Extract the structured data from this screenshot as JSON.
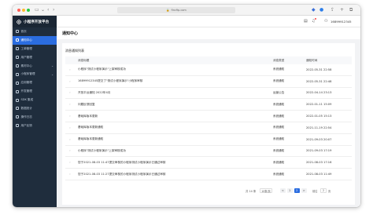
{
  "browser": {
    "url": "fincfip.com"
  },
  "sidebar": {
    "brand": "小程序开放平台",
    "items": [
      {
        "label": "首页",
        "active": false,
        "has_arrow": false
      },
      {
        "label": "通知中心",
        "active": true,
        "has_arrow": false
      },
      {
        "label": "工单管理",
        "active": false,
        "has_arrow": false
      },
      {
        "label": "用户管理",
        "active": false,
        "has_arrow": false
      },
      {
        "label": "素材中心",
        "active": false,
        "has_arrow": true
      },
      {
        "label": "小程序管理",
        "active": false,
        "has_arrow": true
      },
      {
        "label": "应用管理",
        "active": false,
        "has_arrow": false
      },
      {
        "label": "开发管理",
        "active": false,
        "has_arrow": false
      },
      {
        "label": "SDK 集成",
        "active": false,
        "has_arrow": false
      },
      {
        "label": "数据统计",
        "active": false,
        "has_arrow": false
      },
      {
        "label": "操作日志",
        "active": false,
        "has_arrow": false
      },
      {
        "label": "用户反馈",
        "active": false,
        "has_arrow": false
      }
    ]
  },
  "header": {
    "username": "16899912345"
  },
  "page": {
    "title": "通知中心",
    "card_title": "消息通知列表"
  },
  "table": {
    "columns": [
      "消息标题",
      "消息类型",
      "通知时间"
    ],
    "rows": [
      {
        "title": "小程序\"测试小程序演示\"上架审核成功",
        "type": "系统通知",
        "time": "2022-05-31 22:58"
      },
      {
        "title": "16899912345提交了\"测试小程序演示\"小程序审核",
        "type": "系统通知",
        "time": "2022-05-31 22:48"
      },
      {
        "title": "开放平台通知 2022年4月",
        "type": "运营公告",
        "time": "2022-04-14 23:13"
      },
      {
        "title": "问题反馈回复",
        "type": "系统通知",
        "time": "2022-01-11 15:09"
      },
      {
        "title": "基础库版本更新",
        "type": "系统通知",
        "time": "2022-01-05 15:13"
      },
      {
        "title": "基础库版本更新通知",
        "type": "系统通知",
        "time": "2021-11-19 22:54"
      },
      {
        "title": "基础库版本更新通知",
        "type": "系统通知",
        "time": "2021-09-03 20:07"
      },
      {
        "title": "小程序\"测试小程序演示\"上架审核成功",
        "type": "系统通知",
        "time": "2021-09-03 17:19"
      },
      {
        "title": "您于2021-08-03 11:47提交审核的小程序测试小程序演示已通过审核",
        "type": "系统通知",
        "time": "2021-08-03 17:16"
      },
      {
        "title": "您于2021-08-03 11:27提交审核的小程序测试小程序演示已通过审核",
        "type": "系统通知",
        "time": "2021-08-03 11:49"
      }
    ]
  },
  "pagination": {
    "total": "共 14 条",
    "page_size": "10条/页",
    "prev": "<",
    "pages": [
      "1",
      "2"
    ],
    "current": "2",
    "next": ">",
    "goto_label": "前往",
    "goto_value": "2",
    "goto_suffix": "页"
  },
  "colors": {
    "sidebar_bg": "#1f2d3d",
    "accent": "#2b6de0"
  }
}
